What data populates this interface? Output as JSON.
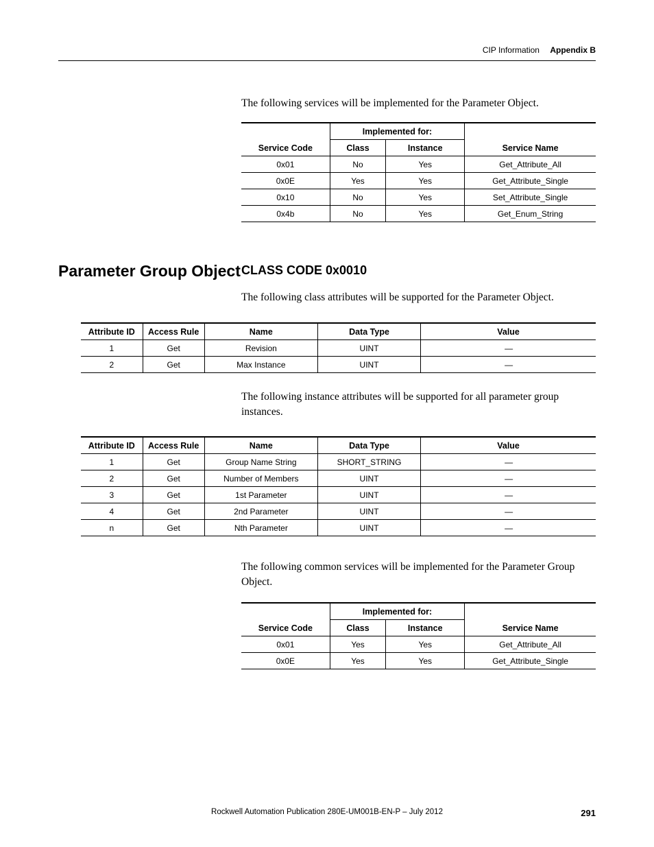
{
  "header": {
    "light": "CIP Information",
    "bold": "Appendix B"
  },
  "intro1": "The following services will be implemented for the Parameter Object.",
  "table1": {
    "h_impl": "Implemented for:",
    "h_code": "Service Code",
    "h_class": "Class",
    "h_inst": "Instance",
    "h_name": "Service Name",
    "r": [
      {
        "code": "0x01",
        "class": "No",
        "inst": "Yes",
        "name": "Get_Attribute_All"
      },
      {
        "code": "0x0E",
        "class": "Yes",
        "inst": "Yes",
        "name": "Get_Attribute_Single"
      },
      {
        "code": "0x10",
        "class": "No",
        "inst": "Yes",
        "name": "Set_Attribute_Single"
      },
      {
        "code": "0x4b",
        "class": "No",
        "inst": "Yes",
        "name": "Get_Enum_String"
      }
    ]
  },
  "side_heading": "Parameter Group Object",
  "sub_heading": "CLASS CODE 0x0010",
  "para2": "The following class attributes will be supported for the Parameter Object.",
  "table2": {
    "h_attr": "Attribute ID",
    "h_rule": "Access Rule",
    "h_name": "Name",
    "h_dtype": "Data Type",
    "h_val": "Value",
    "r": [
      {
        "attr": "1",
        "rule": "Get",
        "name": "Revision",
        "dtype": "UINT",
        "val": "—"
      },
      {
        "attr": "2",
        "rule": "Get",
        "name": "Max Instance",
        "dtype": "UINT",
        "val": "—"
      }
    ]
  },
  "para3": "The following instance attributes will be supported for all parameter group instances.",
  "table3": {
    "h_attr": "Attribute ID",
    "h_rule": "Access Rule",
    "h_name": "Name",
    "h_dtype": "Data Type",
    "h_val": "Value",
    "r": [
      {
        "attr": "1",
        "rule": "Get",
        "name": "Group Name String",
        "dtype": "SHORT_STRING",
        "val": "—"
      },
      {
        "attr": "2",
        "rule": "Get",
        "name": "Number of Members",
        "dtype": "UINT",
        "val": "—"
      },
      {
        "attr": "3",
        "rule": "Get",
        "name": "1st Parameter",
        "dtype": "UINT",
        "val": "—"
      },
      {
        "attr": "4",
        "rule": "Get",
        "name": "2nd Parameter",
        "dtype": "UINT",
        "val": "—"
      },
      {
        "attr": "n",
        "rule": "Get",
        "name": "Nth Parameter",
        "dtype": "UINT",
        "val": "—"
      }
    ]
  },
  "para4": "The following common services will be implemented for the Parameter Group Object.",
  "table4": {
    "h_impl": "Implemented for:",
    "h_code": "Service Code",
    "h_class": "Class",
    "h_inst": "Instance",
    "h_name": "Service Name",
    "r": [
      {
        "code": "0x01",
        "class": "Yes",
        "inst": "Yes",
        "name": "Get_Attribute_All"
      },
      {
        "code": "0x0E",
        "class": "Yes",
        "inst": "Yes",
        "name": "Get_Attribute_Single"
      }
    ]
  },
  "footer": {
    "text": "Rockwell Automation Publication 280E-UM001B-EN-P – July 2012",
    "page": "291"
  }
}
